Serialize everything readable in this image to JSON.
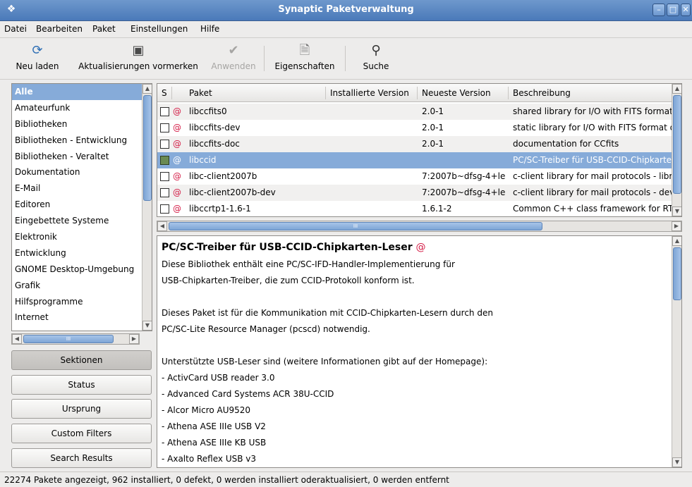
{
  "window": {
    "title": "Synaptic Paketverwaltung"
  },
  "menu": [
    "Datei",
    "Bearbeiten",
    "Paket",
    "Einstellungen",
    "Hilfe"
  ],
  "toolbar": {
    "reload": "Neu laden",
    "mark_updates": "Aktualisierungen vormerken",
    "apply": "Anwenden",
    "properties": "Eigenschaften",
    "search": "Suche"
  },
  "sidebar": {
    "items": [
      "Alle",
      "Amateurfunk",
      "Bibliotheken",
      "Bibliotheken - Entwicklung",
      "Bibliotheken - Veraltet",
      "Dokumentation",
      "E-Mail",
      "Editoren",
      "Eingebettete Systeme",
      "Elektronik",
      "Entwicklung",
      "GNOME Desktop-Umgebung",
      "Grafik",
      "Hilfsprogramme",
      "Internet"
    ],
    "selected": "Alle",
    "hscroll_glyph": "III",
    "filters": [
      "Sektionen",
      "Status",
      "Ursprung",
      "Custom Filters",
      "Search Results"
    ],
    "active_filter": "Sektionen"
  },
  "packages": {
    "columns": {
      "s": "S",
      "name": "Paket",
      "installed": "Installierte Version",
      "latest": "Neueste Version",
      "desc": "Beschreibung"
    },
    "rows": [
      {
        "name": "libccfits0",
        "installed": "",
        "latest": "2.0-1",
        "desc": "shared library for I/O with FITS format"
      },
      {
        "name": "libccfits-dev",
        "installed": "",
        "latest": "2.0-1",
        "desc": "static library for I/O with FITS format d"
      },
      {
        "name": "libccfits-doc",
        "installed": "",
        "latest": "2.0-1",
        "desc": "documentation for CCfits"
      },
      {
        "name": "libccid",
        "installed": "",
        "latest": "",
        "desc": "PC/SC-Treiber für USB-CCID-Chipkarte"
      },
      {
        "name": "libc-client2007b",
        "installed": "",
        "latest": "7:2007b~dfsg-4+le",
        "desc": "c-client library for mail protocols - libra"
      },
      {
        "name": "libc-client2007b-dev",
        "installed": "",
        "latest": "7:2007b~dfsg-4+le",
        "desc": "c-client library for mail protocols - dev"
      },
      {
        "name": "libccrtp1-1.6-1",
        "installed": "",
        "latest": "1.6.1-2",
        "desc": "Common C++ class framework for RT"
      }
    ],
    "selected_index": 3,
    "hscroll_glyph": "III"
  },
  "description": {
    "title": "PC/SC-Treiber für USB-CCID-Chipkarten-Leser",
    "lines": [
      "Diese Bibliothek enthält eine PC/SC-IFD-Handler-Implementierung für",
      "USB-Chipkarten-Treiber, die zum CCID-Protokoll konform ist.",
      "",
      "Dieses Paket ist für die Kommunikation mit CCID-Chipkarten-Lesern durch den",
      "PC/SC-Lite Resource Manager (pcscd) notwendig.",
      "",
      "Unterstützte USB-Leser sind (weitere Informationen gibt auf der Homepage):",
      " - ActivCard USB reader 3.0",
      " - Advanced Card Systems ACR 38U-CCID",
      " - Alcor Micro AU9520",
      " - Athena ASE IIIe USB V2",
      " - Athena ASE IIIe KB USB",
      " - Axalto Reflex USB v3"
    ]
  },
  "status": "22274 Pakete angezeigt, 962 installiert, 0 defekt, 0 werden installiert oderaktualisiert, 0 werden entfernt",
  "colors": {
    "selection": "#86abd9",
    "titlebar": "#4a79b9",
    "debian_red": "#d41b45"
  }
}
